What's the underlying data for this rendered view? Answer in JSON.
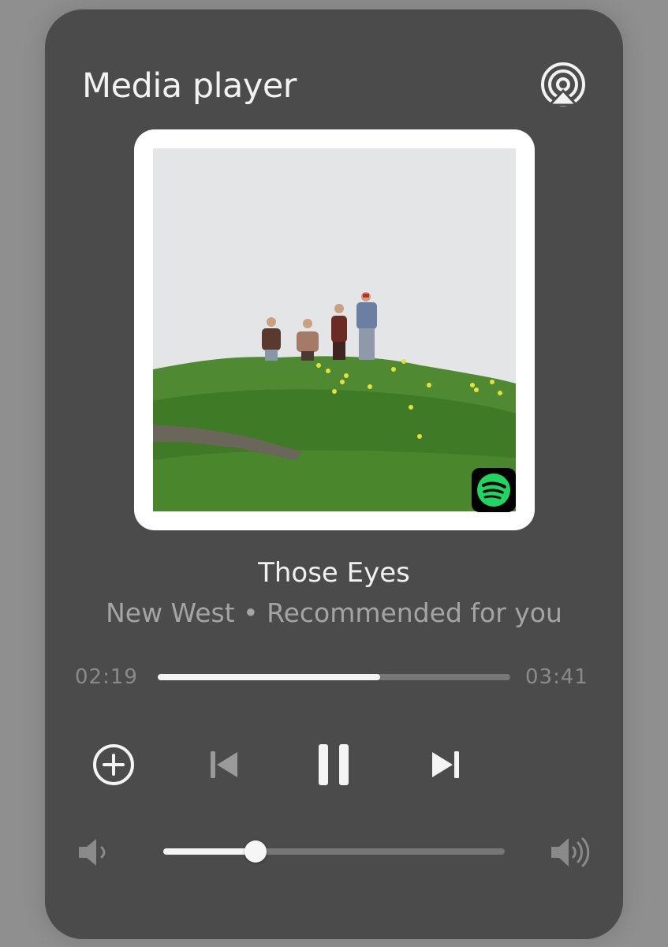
{
  "header": {
    "title": "Media player",
    "airplay_icon": "airplay-icon"
  },
  "track": {
    "title": "Those Eyes",
    "subtitle": "New West • Recommended for you",
    "elapsed": "02:19",
    "duration": "03:41",
    "progress": 0.63
  },
  "artwork": {
    "badge_icon": "spotify-icon",
    "badge_color": "#1ed760"
  },
  "controls": {
    "add_icon": "plus-circle-icon",
    "prev_icon": "skip-previous-icon",
    "play_pause_icon": "pause-icon",
    "next_icon": "skip-next-icon"
  },
  "volume": {
    "level": 0.27,
    "low_icon": "volume-low-icon",
    "high_icon": "volume-high-icon"
  }
}
